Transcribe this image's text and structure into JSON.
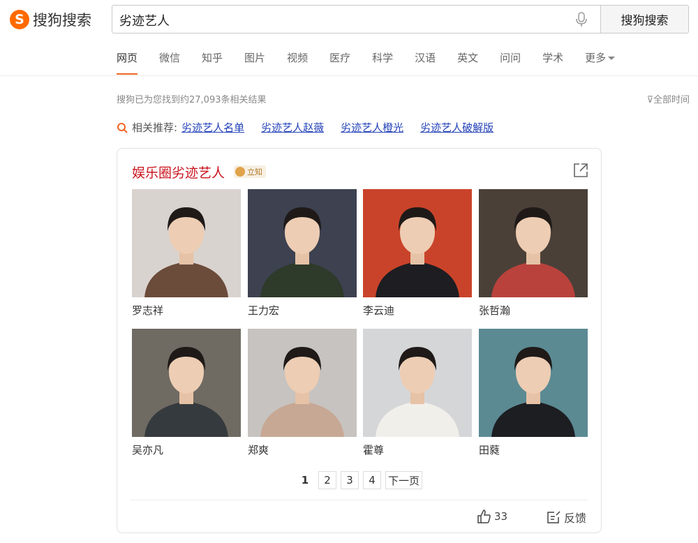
{
  "brand": {
    "logo_letter": "S",
    "logo_text": "搜狗搜索",
    "accent": "#ff6a00"
  },
  "search": {
    "query": "劣迹艺人",
    "button_label": "搜狗搜索"
  },
  "nav": {
    "tabs": [
      "网页",
      "微信",
      "知乎",
      "图片",
      "视频",
      "医疗",
      "科学",
      "汉语",
      "英文",
      "问问",
      "学术",
      "更多"
    ],
    "active": "网页"
  },
  "results": {
    "count_text": "搜狗已为您找到约27,093条相关结果",
    "time_filter": "全部时间"
  },
  "related": {
    "label": "相关推荐:",
    "links": [
      "劣迹艺人名单",
      "劣迹艺人赵薇",
      "劣迹艺人橙光",
      "劣迹艺人破解版"
    ]
  },
  "card": {
    "title": "娱乐圈劣迹艺人",
    "badge": "立知",
    "people": [
      {
        "name": "罗志祥",
        "bg": "#d9d3cf",
        "fg": "#6b4b3a"
      },
      {
        "name": "王力宏",
        "bg": "#3d4150",
        "fg": "#2e3a2a"
      },
      {
        "name": "李云迪",
        "bg": "#c9432a",
        "fg": "#1d1d22"
      },
      {
        "name": "张哲瀚",
        "bg": "#4a4038",
        "fg": "#b9423c"
      },
      {
        "name": "吴亦凡",
        "bg": "#6f6a62",
        "fg": "#353a3e"
      },
      {
        "name": "郑爽",
        "bg": "#c7c3c0",
        "fg": "#c7a894"
      },
      {
        "name": "霍尊",
        "bg": "#d5d6d8",
        "fg": "#f1efea"
      },
      {
        "name": "田蕤",
        "bg": "#5b8a93",
        "fg": "#1c1e22"
      }
    ],
    "pagination": [
      "1",
      "2",
      "3",
      "4",
      "下一页"
    ],
    "current_page": "1",
    "likes": "33",
    "feedback_label": "反馈"
  }
}
